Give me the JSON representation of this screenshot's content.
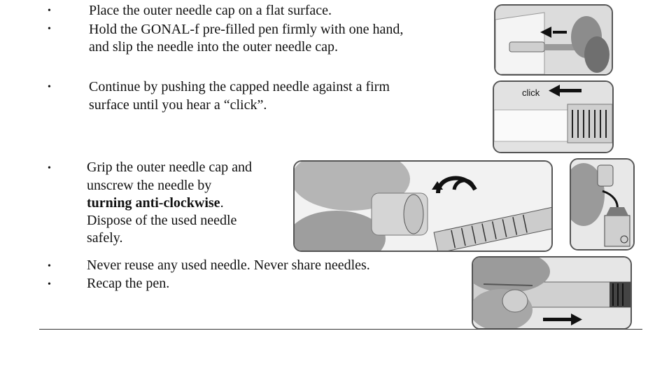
{
  "steps": [
    {
      "bullet": "•",
      "lines": [
        "Place the outer needle cap on a flat surface."
      ]
    },
    {
      "bullet": "•",
      "lines": [
        "Hold the GONAL-f pre-filled pen firmly with one hand,",
        "and slip the needle into the outer needle cap."
      ]
    },
    {
      "bullet": "•",
      "lines": [
        "Continue by pushing the capped needle against a firm",
        "surface until you hear a “click”."
      ]
    },
    {
      "bullet": "•",
      "lines": [
        "Grip the outer needle cap and",
        "unscrew the needle by"
      ],
      "bold": "turning anti-clockwise",
      "bold_tail": ".",
      "after": [
        "Dispose of the used needle",
        "safely."
      ]
    },
    {
      "bullet": "•",
      "lines": [
        "Never reuse any used needle. Never share needles."
      ]
    },
    {
      "bullet": "•",
      "lines": [
        "Recap the pen."
      ]
    }
  ],
  "figures": {
    "click_label": "click"
  }
}
